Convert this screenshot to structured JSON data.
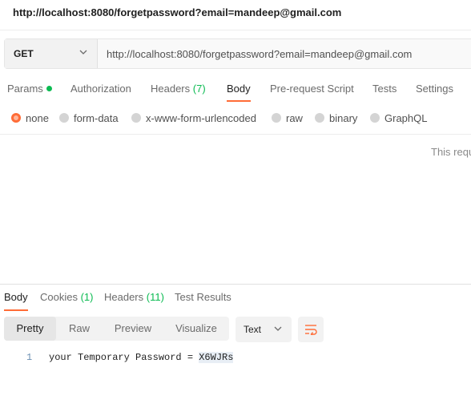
{
  "title": "http://localhost:8080/forgetpassword?email=mandeep@gmail.com",
  "request": {
    "method": "GET",
    "url": "http://localhost:8080/forgetpassword?email=mandeep@gmail.com"
  },
  "request_tabs": [
    {
      "label": "Params",
      "count": ""
    },
    {
      "label": "Authorization",
      "count": ""
    },
    {
      "label": "Headers",
      "count": "(7)"
    },
    {
      "label": "Body",
      "count": ""
    },
    {
      "label": "Pre-request Script",
      "count": ""
    },
    {
      "label": "Tests",
      "count": ""
    },
    {
      "label": "Settings",
      "count": ""
    }
  ],
  "active_request_tab": "Body",
  "body_types": [
    "none",
    "form-data",
    "x-www-form-urlencoded",
    "raw",
    "binary",
    "GraphQL"
  ],
  "selected_body_type": "none",
  "body_empty_message": "This requ",
  "response_tabs": [
    {
      "label": "Body",
      "count": ""
    },
    {
      "label": "Cookies",
      "count": "(1)"
    },
    {
      "label": "Headers",
      "count": "(11)"
    },
    {
      "label": "Test Results",
      "count": ""
    }
  ],
  "active_response_tab": "Body",
  "view_modes": [
    "Pretty",
    "Raw",
    "Preview",
    "Visualize"
  ],
  "active_view_mode": "Pretty",
  "format": "Text",
  "response_body": {
    "line_number": "1",
    "text_prefix": "your Temporary Password = ",
    "text_highlight": "X6WJRs"
  },
  "colors": {
    "accent": "#ff6c37",
    "count_green": "#0cbb52"
  }
}
